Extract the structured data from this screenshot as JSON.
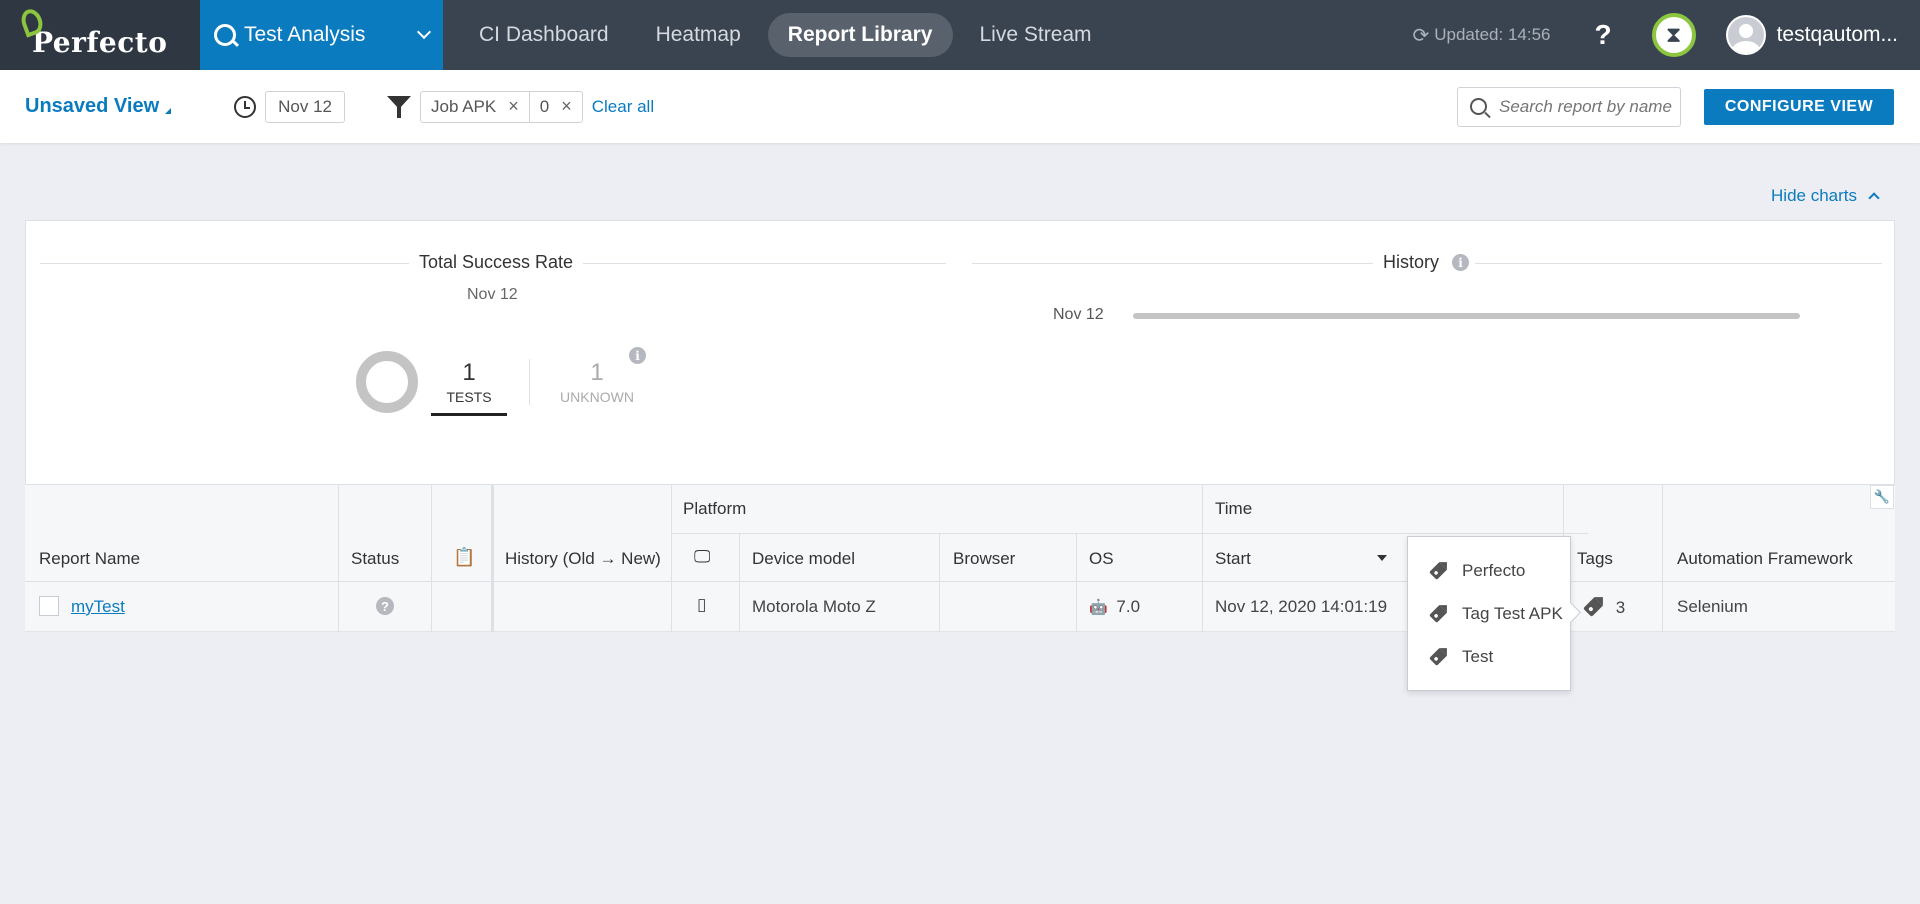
{
  "nav": {
    "logo": "Perfecto",
    "product": "Test Analysis",
    "tabs": [
      "CI Dashboard",
      "Heatmap",
      "Report Library",
      "Live Stream"
    ],
    "active_tab": "Report Library",
    "updated": "Updated: 14:56",
    "help": "?",
    "username": "testqautom..."
  },
  "filterbar": {
    "view_name": "Unsaved View",
    "date": "Nov 12",
    "filters": [
      "Job APK",
      "0"
    ],
    "clear_all": "Clear all",
    "search_placeholder": "Search report by name",
    "configure": "CONFIGURE VIEW"
  },
  "hide_charts": "Hide charts",
  "charts": {
    "success": {
      "title": "Total Success Rate",
      "date": "Nov 12",
      "tests_count": "1",
      "tests_label": "TESTS",
      "unknown_count": "1",
      "unknown_label": "UNKNOWN"
    },
    "history": {
      "title": "History",
      "date": "Nov 12"
    }
  },
  "table": {
    "group_headers": {
      "platform": "Platform",
      "time": "Time"
    },
    "headers": {
      "report_name": "Report Name",
      "status": "Status",
      "history": "History (Old → New)",
      "device_model": "Device model",
      "browser": "Browser",
      "os": "OS",
      "start": "Start",
      "tags": "Tags",
      "framework": "Automation Framework"
    },
    "rows": [
      {
        "name": "myTest",
        "status": "?",
        "device_model": "Motorola Moto Z",
        "browser": "",
        "os_version": "7.0",
        "start": "Nov 12, 2020 14:01:19",
        "tags_count": "3",
        "framework": "Selenium"
      }
    ]
  },
  "tags_popup": [
    "Perfecto",
    "Tag Test APK",
    "Test"
  ]
}
